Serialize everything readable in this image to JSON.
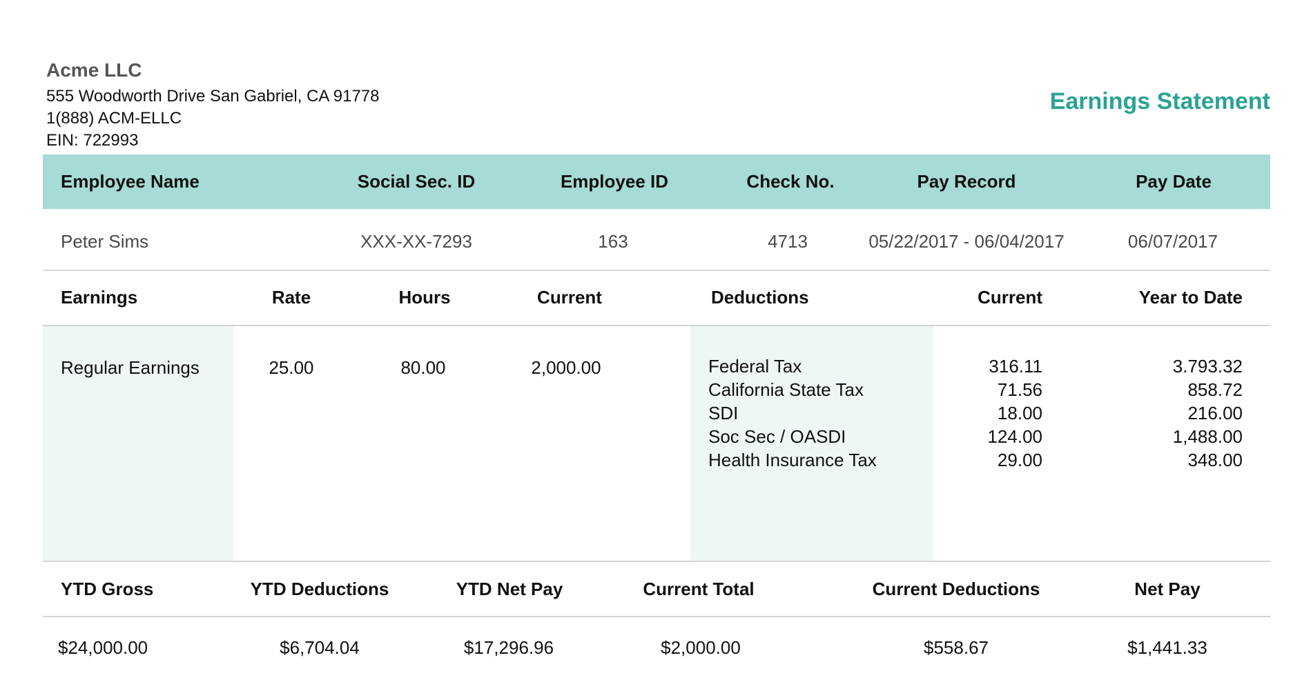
{
  "company": {
    "name": "Acme LLC",
    "address": "555 Woodworth Drive San Gabriel, CA  91778",
    "phone": "1(888) ACM-ELLC",
    "ein": "EIN: 722993"
  },
  "document_title": "Earnings Statement",
  "employee_header": {
    "employee_name": "Employee Name",
    "social_sec_id": "Social Sec. ID",
    "employee_id": "Employee ID",
    "check_no": "Check No.",
    "pay_record": "Pay Record",
    "pay_date": "Pay Date"
  },
  "employee": {
    "employee_name": "Peter Sims",
    "social_sec_id": "XXX-XX-7293",
    "employee_id": "163",
    "check_no": "4713",
    "pay_record": "05/22/2017 - 06/04/2017",
    "pay_date": "06/07/2017"
  },
  "detail_header": {
    "earnings": "Earnings",
    "rate": "Rate",
    "hours": "Hours",
    "current": "Current",
    "deductions": "Deductions",
    "deductions_current": "Current",
    "year_to_date": "Year to Date"
  },
  "earnings": [
    {
      "label": "Regular Earnings",
      "rate": "25.00",
      "hours": "80.00",
      "current": "2,000.00"
    }
  ],
  "deductions": [
    {
      "label": "Federal Tax",
      "current": "316.11",
      "ytd": "3.793.32"
    },
    {
      "label": "California State Tax",
      "current": "71.56",
      "ytd": "858.72"
    },
    {
      "label": "SDI",
      "current": "18.00",
      "ytd": "216.00"
    },
    {
      "label": "Soc Sec / OASDI",
      "current": "124.00",
      "ytd": "1,488.00"
    },
    {
      "label": "Health Insurance Tax",
      "current": "29.00",
      "ytd": "348.00"
    }
  ],
  "summary_header": {
    "ytd_gross": "YTD Gross",
    "ytd_deductions": "YTD Deductions",
    "ytd_net_pay": "YTD Net Pay",
    "current_total": "Current Total",
    "current_deductions": "Current Deductions",
    "net_pay": "Net Pay"
  },
  "summary": {
    "ytd_gross": "$24,000.00",
    "ytd_deductions": "$6,704.04",
    "ytd_net_pay": "$17,296.96",
    "current_total": "$2,000.00",
    "current_deductions": "$558.67",
    "net_pay": "$1,441.33"
  },
  "colors": {
    "accent": "#2aa394",
    "header_band": "#a6dcd5",
    "column_tint": "#eef7f5"
  }
}
